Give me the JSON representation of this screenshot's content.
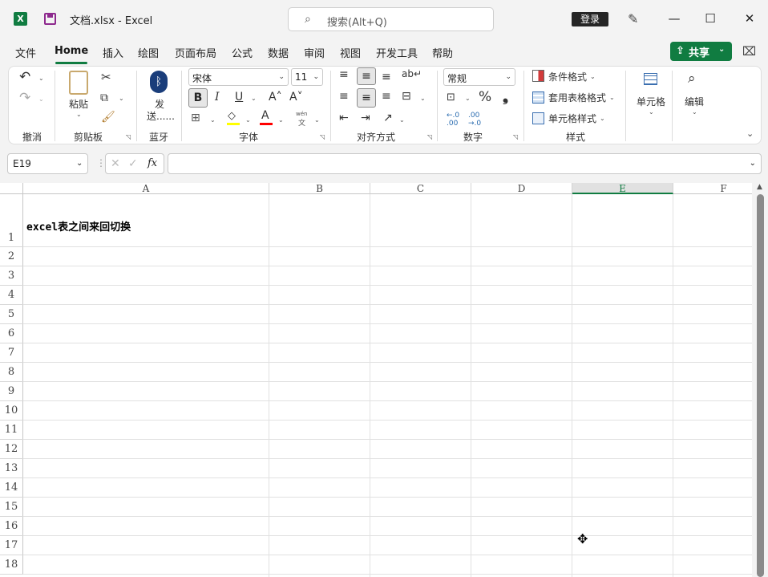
{
  "titlebar": {
    "app_logo": "X",
    "file_title": "文档.xlsx  -  Excel",
    "search_placeholder": "搜索(Alt+Q)",
    "login_label": "登录",
    "minimize": "—",
    "maximize": "☐",
    "close": "✕"
  },
  "menu": {
    "tabs": [
      "文件",
      "Home",
      "插入",
      "绘图",
      "页面布局",
      "公式",
      "数据",
      "审阅",
      "视图",
      "开发工具",
      "帮助"
    ],
    "share_label": "共享"
  },
  "ribbon": {
    "groups": {
      "undo": "撤消",
      "clipboard": "剪贴板",
      "bluetooth": "蓝牙",
      "font": "字体",
      "align": "对齐方式",
      "number": "数字",
      "styles": "样式"
    },
    "paste_label": "粘贴",
    "send_label_1": "发",
    "send_label_2": "送......",
    "font_name": "宋体",
    "font_size": "11",
    "bold": "B",
    "italic": "I",
    "underline": "U",
    "grow_font": "A˄",
    "shrink_font": "A˅",
    "phonetic_top": "wén",
    "phonetic_bottom": "文",
    "number_format": "常规",
    "percent": "%",
    "comma": "❟",
    "cond_format": "条件格式",
    "table_format": "套用表格格式",
    "cell_style": "单元格样式",
    "cells_label": "单元格",
    "edit_label": "编辑"
  },
  "formula_bar": {
    "name_box": "E19",
    "fx": "fx",
    "value": ""
  },
  "sheet": {
    "columns": [
      "A",
      "B",
      "C",
      "D",
      "E",
      "F"
    ],
    "selected_column": "E",
    "rows": [
      "1",
      "2",
      "3",
      "4",
      "5",
      "6",
      "7",
      "8",
      "9",
      "10",
      "11",
      "12",
      "13",
      "14",
      "15",
      "16",
      "17",
      "18"
    ],
    "cell_a1": "excel表之间来回切换"
  },
  "colors": {
    "accent": "#107c41"
  }
}
